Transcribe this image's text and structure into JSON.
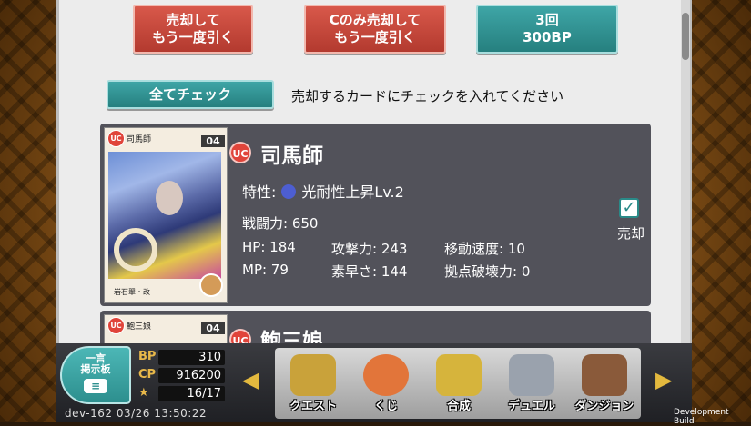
{
  "actions": {
    "sell_redraw": "売却して\nもう一度引く",
    "sell_c_redraw": "Cのみ売却して\nもう一度引く",
    "draw3": "3回\n300BP"
  },
  "check_all": "全てチェック",
  "instruction": "売却するカードにチェックを入れてください",
  "cards": [
    {
      "thumb_name": "司馬師",
      "cost": "04",
      "rarity": "UC",
      "name": "司馬師",
      "trait_label": "特性:",
      "trait_value": "光耐性上昇Lv.2",
      "power": "戦闘力: 650",
      "hp": "HP: 184",
      "atk": "攻撃力: 243",
      "move": "移動速度: 10",
      "mp": "MP: 79",
      "agi": "素早さ: 144",
      "siege": "拠点破壊力: 0",
      "sub_label": "岩石翠・改",
      "sell_label": "売却",
      "sell_checked": true
    },
    {
      "thumb_name": "鮑三娘",
      "cost": "04",
      "rarity": "UC",
      "name": "鮑三娘"
    }
  ],
  "bbs": {
    "line1": "一言",
    "line2": "掲示板"
  },
  "stats": [
    {
      "label": "BP",
      "value": "310"
    },
    {
      "label": "CP",
      "value": "916200"
    },
    {
      "label": "★",
      "value": "16/17"
    }
  ],
  "footer": "dev-162  03/26 13:50:22",
  "menu": [
    {
      "label": "クエスト",
      "icon": "quest-icon",
      "color": "#c9a23a"
    },
    {
      "label": "くじ",
      "icon": "lottery-icon",
      "color": "#e2753a"
    },
    {
      "label": "合成",
      "icon": "fusion-icon",
      "color": "#d6b43c"
    },
    {
      "label": "デュエル",
      "icon": "duel-icon",
      "color": "#9aa2ad"
    },
    {
      "label": "ダンジョン",
      "icon": "dungeon-icon",
      "color": "#8a5a3a"
    }
  ],
  "dev_build": "Development Build"
}
